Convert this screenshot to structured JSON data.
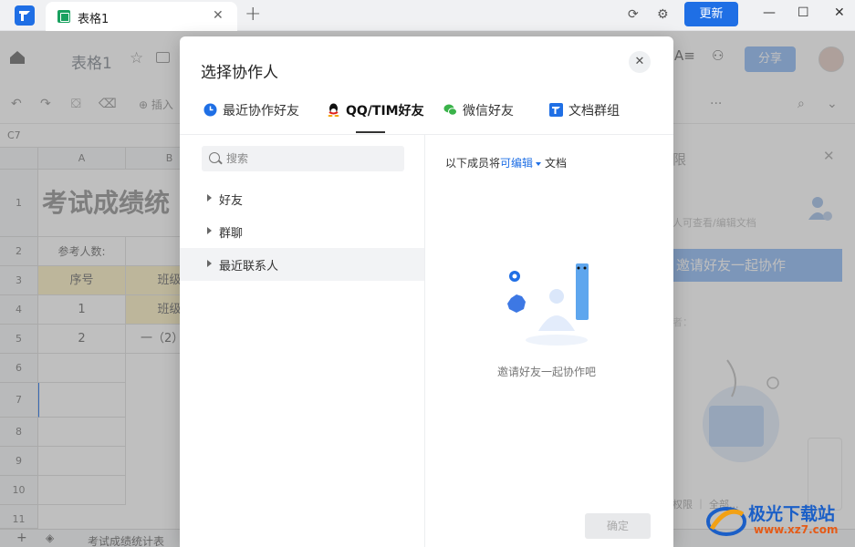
{
  "titlebar": {
    "tab_title": "表格1",
    "tab_close": "✕",
    "tab_add": "+",
    "update_label": "更新",
    "sync_icon": "⟳",
    "settings_icon": "⚙",
    "minimize": "—",
    "maximize": "☐",
    "close": "✕"
  },
  "docheader": {
    "title": "表格1",
    "star": "☆",
    "share_label": "分享"
  },
  "toolbar": {
    "undo": "↶",
    "redo": "↷",
    "format_painter": "⛋",
    "eraser": "⌫",
    "insert_label": "⊕ 插入",
    "more": "···",
    "search": "⌕",
    "collapse": "⌄"
  },
  "sheet": {
    "cell_ref": "C7",
    "columns": [
      "A",
      "B"
    ],
    "rows": [
      "1",
      "2",
      "3",
      "4",
      "5",
      "6",
      "7",
      "8",
      "9",
      "10",
      "11"
    ],
    "title_cell": "考试成绩统",
    "participants_label": "参考人数:",
    "header_seq": "序号",
    "header_class": "班级",
    "row4_seq": "1",
    "row4_class": "班级",
    "row5_seq": "2",
    "row5_class": "一（2）",
    "sheet_tab": "考试成绩统计表"
  },
  "right_panel": {
    "title": "限",
    "close": "✕",
    "desc": "人可查看/编辑文档",
    "invite_label": "邀请好友一起协作",
    "sub_label": "者：",
    "footer": "权限 ｜ 全部..."
  },
  "dialog": {
    "title": "选择协作人",
    "close": "✕",
    "tabs": [
      {
        "label": "最近协作好友",
        "icon": "clock-icon"
      },
      {
        "label": "QQ/TIM好友",
        "icon": "qq-icon"
      },
      {
        "label": "微信好友",
        "icon": "wechat-icon"
      },
      {
        "label": "文档群组",
        "icon": "docs-group-icon"
      }
    ],
    "active_tab": "QQ/TIM好友",
    "search_placeholder": "搜索",
    "tree": [
      "好友",
      "群聊",
      "最近联系人"
    ],
    "perm_prefix": "以下成员将",
    "perm_value": "可编辑",
    "perm_suffix": "文档",
    "empty_text": "邀请好友一起协作吧",
    "confirm_label": "确定"
  },
  "watermark": {
    "text": "极光下载站",
    "url": "www.xz7.com"
  },
  "colors": {
    "accent": "#1f6fe5",
    "share_disabled": "#a6c8f7",
    "sheet_header_fill": "#fdf3cf"
  }
}
